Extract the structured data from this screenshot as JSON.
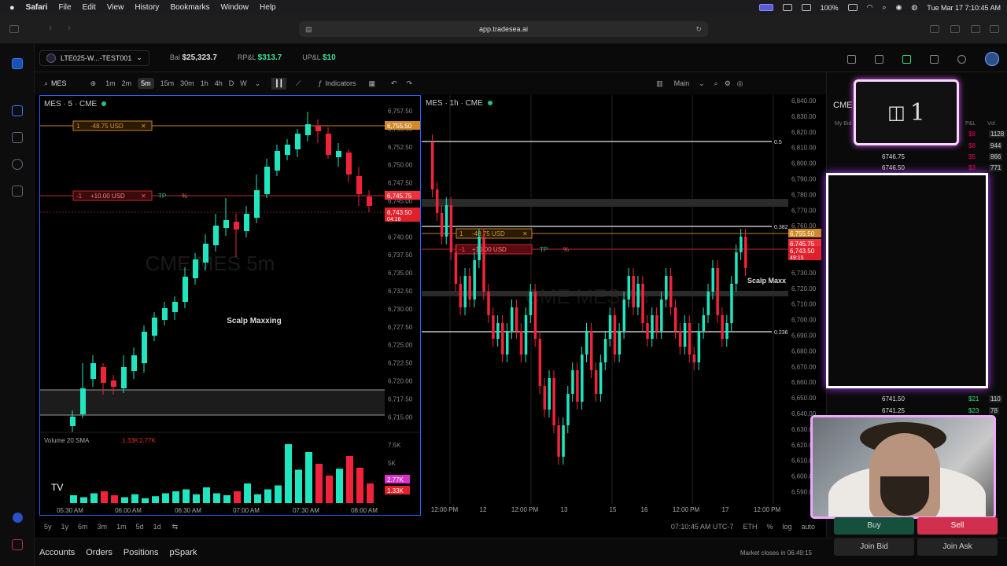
{
  "menubar": {
    "app": "Safari",
    "items": [
      "File",
      "Edit",
      "View",
      "History",
      "Bookmarks",
      "Window",
      "Help"
    ],
    "battery": "100%",
    "datetime": "Tue Mar 17  7:10:45 AM"
  },
  "browser": {
    "url": "app.tradesea.ai"
  },
  "account": {
    "name": "LTE025-W...-TEST001",
    "bal_label": "Bal",
    "bal_value": "$25,323.7",
    "rpl_label": "RP&L",
    "rpl_value": "$313.7",
    "upl_label": "UP&L",
    "upl_value": "$10"
  },
  "toolbar": {
    "symbol": "MES",
    "intervals": [
      "1m",
      "2m",
      "5m",
      "15m",
      "30m",
      "1h",
      "4h",
      "D",
      "W"
    ],
    "selected_interval": "5m",
    "indicators_label": "Indicators",
    "layout_label": "Main"
  },
  "chart1": {
    "title": "MES · 5 · CME",
    "watermark": "CME MES 5m",
    "annotation": "Scalp Maxxing",
    "order1": {
      "qty": "1",
      "text": "-48.75 USD"
    },
    "order2": {
      "qty": "-1",
      "text": "+10.00 USD",
      "tp": "TP",
      "sl": "%"
    },
    "price_labels": [
      "6,757.50",
      "6,755.50",
      "6,752.50",
      "6,750.00",
      "6,747.50",
      "6,745.00",
      "6,742.50",
      "6,740.00",
      "6,737.50",
      "6,735.00",
      "6,732.50",
      "6,730.00",
      "6,727.50",
      "6,725.00",
      "6,722.50",
      "6,720.00",
      "6,717.50",
      "6,715.00"
    ],
    "tags": [
      {
        "text": "6,755.50",
        "color": "#d08a2a"
      },
      {
        "text": "6,745.75",
        "color": "#f0303a"
      },
      {
        "text": "6,743.50",
        "color": "#e0202a",
        "sub": "04:16"
      }
    ],
    "time_labels": [
      "05:30 AM",
      "06:00 AM",
      "06:30 AM",
      "07:00 AM",
      "07:30 AM",
      "08:00 AM"
    ],
    "volume": {
      "label": "Volume 20 SMA",
      "v1": "1.33K",
      "v2": "2.77K",
      "scale": [
        "7.5K",
        "5K"
      ],
      "tag_green": "2.77K",
      "tag_red": "1.33K"
    }
  },
  "chart2": {
    "title": "MES · 1h · CME",
    "watermark": "CME MES 1h",
    "annotation": "Scalp Maxx",
    "order1": {
      "qty": "1",
      "text": "-48.75 USD"
    },
    "order2": {
      "qty": "-1",
      "text": "+10.00 USD",
      "tp": "TP",
      "sl": "%"
    },
    "fib": [
      "0.5",
      "0.382",
      "0.236"
    ],
    "price_labels": [
      "6,840.00",
      "6,830.00",
      "6,820.00",
      "6,810.00",
      "6,800.00",
      "6,790.00",
      "6,780.00",
      "6,770.00",
      "6,760.00",
      "6,750.00",
      "6,740.00",
      "6,730.00",
      "6,720.00",
      "6,710.00",
      "6,700.00",
      "6,690.00",
      "6,680.00",
      "6,670.00",
      "6,660.00",
      "6,650.00",
      "6,640.00",
      "6,630.00",
      "6,620.00",
      "6,610.00",
      "6,600.00",
      "6,590.00"
    ],
    "tags": [
      {
        "text": "6,755.50",
        "color": "#d08a2a"
      },
      {
        "text": "6,745.75",
        "color": "#f0303a"
      },
      {
        "text": "6,743.50",
        "color": "#e0202a",
        "sub": "49:15"
      }
    ],
    "time_labels": [
      "12:00 PM",
      "12",
      "12:00 PM",
      "13",
      "15",
      "16",
      "12:00 PM",
      "17",
      "12:00 PM"
    ]
  },
  "bottombar": {
    "ranges": [
      "5y",
      "1y",
      "6m",
      "3m",
      "1m",
      "5d",
      "1d"
    ],
    "clock": "07:10:45 AM UTC-7",
    "session": "ETH",
    "opts": [
      "%",
      "log",
      "auto"
    ]
  },
  "tabs": [
    "Accounts",
    "Orders",
    "Positions",
    "pSpark"
  ],
  "market_status": "Market closes in 06:49:15",
  "dom": {
    "header": "CME",
    "cols": [
      "My Bid",
      "P&L",
      "Vol"
    ],
    "rows": [
      {
        "price": "",
        "pl": "$8",
        "vol": "1128"
      },
      {
        "price": "",
        "pl": "$8",
        "vol": "944"
      },
      {
        "price": "6746.75",
        "pl": "$5",
        "vol": "866"
      },
      {
        "price": "6746.50",
        "pl": "$3",
        "vol": "771"
      }
    ],
    "bottom_rows": [
      {
        "price": "6741.50",
        "pl": "$21",
        "vol": "110"
      },
      {
        "price": "6741.25",
        "pl": "$23",
        "vol": "78"
      }
    ],
    "overlay_text": "1",
    "buy": "Buy",
    "sell": "Sell",
    "join_bid": "Join Bid",
    "join_ask": "Join Ask"
  },
  "colors": {
    "up": "#20e6c0",
    "down": "#f0233a",
    "accent": "#2962ff"
  }
}
